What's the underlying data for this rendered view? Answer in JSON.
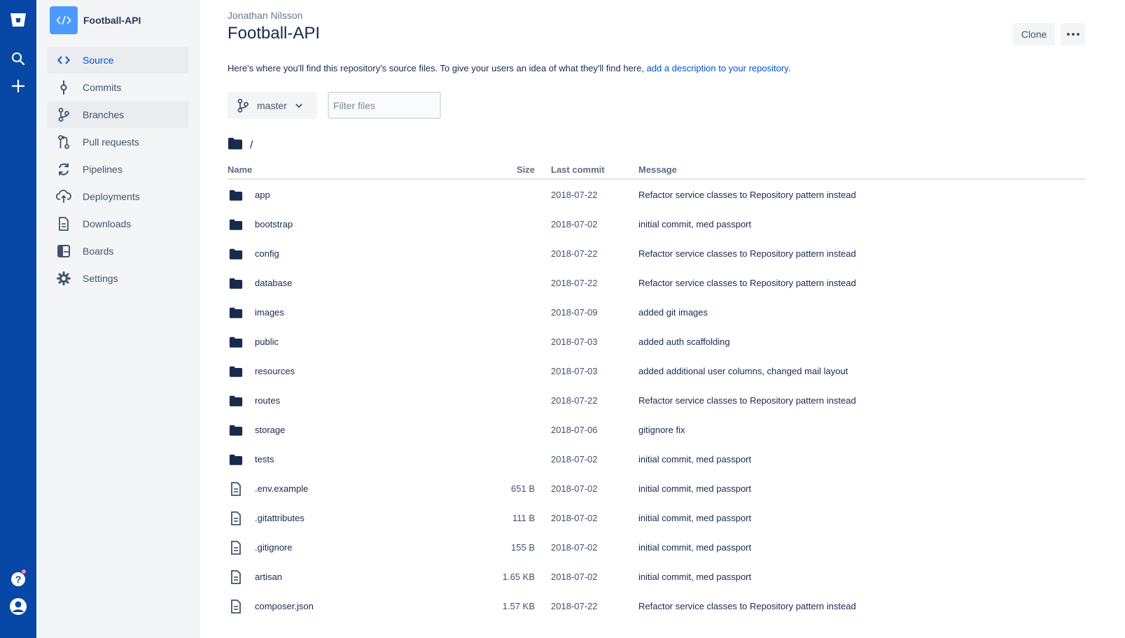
{
  "global_nav": {
    "icons": [
      "bitbucket-logo-icon",
      "search-icon",
      "create-plus-icon",
      "help-icon",
      "profile-avatar-icon"
    ]
  },
  "sidebar": {
    "repo_name": "Football-API",
    "items": [
      {
        "label": "Source",
        "icon": "source-code-icon",
        "active": true
      },
      {
        "label": "Commits",
        "icon": "commit-icon"
      },
      {
        "label": "Branches",
        "icon": "branch-icon",
        "active": true
      },
      {
        "label": "Pull requests",
        "icon": "pull-request-icon"
      },
      {
        "label": "Pipelines",
        "icon": "pipelines-icon"
      },
      {
        "label": "Deployments",
        "icon": "deployments-cloud-icon"
      },
      {
        "label": "Downloads",
        "icon": "downloads-document-icon"
      },
      {
        "label": "Boards",
        "icon": "boards-icon"
      },
      {
        "label": "Settings",
        "icon": "gear-icon"
      }
    ]
  },
  "header": {
    "owner": "Jonathan Nilsson",
    "title": "Football-API",
    "clone_label": "Clone",
    "more_label": "•••"
  },
  "description": {
    "text": "Here's where you'll find this repository's source files. To give your users an idea of what they'll find here, ",
    "link": "add a description to your repository",
    "suffix": "."
  },
  "controls": {
    "branch": "master",
    "filter_placeholder": "Filter files"
  },
  "path": {
    "sep": "/"
  },
  "table": {
    "headers": {
      "name": "Name",
      "size": "Size",
      "last_commit": "Last commit",
      "message": "Message"
    },
    "rows": [
      {
        "type": "folder",
        "name": "app",
        "size": "",
        "date": "2018-07-22",
        "message": "Refactor service classes to Repository pattern instead"
      },
      {
        "type": "folder",
        "name": "bootstrap",
        "size": "",
        "date": "2018-07-02",
        "message": "initial commit, med passport"
      },
      {
        "type": "folder",
        "name": "config",
        "size": "",
        "date": "2018-07-22",
        "message": "Refactor service classes to Repository pattern instead"
      },
      {
        "type": "folder",
        "name": "database",
        "size": "",
        "date": "2018-07-22",
        "message": "Refactor service classes to Repository pattern instead"
      },
      {
        "type": "folder",
        "name": "images",
        "size": "",
        "date": "2018-07-09",
        "message": "added git images"
      },
      {
        "type": "folder",
        "name": "public",
        "size": "",
        "date": "2018-07-03",
        "message": "added auth scaffolding"
      },
      {
        "type": "folder",
        "name": "resources",
        "size": "",
        "date": "2018-07-03",
        "message": "added additional user columns, changed mail layout"
      },
      {
        "type": "folder",
        "name": "routes",
        "size": "",
        "date": "2018-07-22",
        "message": "Refactor service classes to Repository pattern instead"
      },
      {
        "type": "folder",
        "name": "storage",
        "size": "",
        "date": "2018-07-06",
        "message": "gitignore fix"
      },
      {
        "type": "folder",
        "name": "tests",
        "size": "",
        "date": "2018-07-02",
        "message": "initial commit, med passport"
      },
      {
        "type": "file",
        "name": ".env.example",
        "size": "651 B",
        "date": "2018-07-02",
        "message": "initial commit, med passport"
      },
      {
        "type": "file",
        "name": ".gitattributes",
        "size": "111 B",
        "date": "2018-07-02",
        "message": "initial commit, med passport"
      },
      {
        "type": "file",
        "name": ".gitignore",
        "size": "155 B",
        "date": "2018-07-02",
        "message": "initial commit, med passport"
      },
      {
        "type": "file",
        "name": "artisan",
        "size": "1.65 KB",
        "date": "2018-07-02",
        "message": "initial commit, med passport"
      },
      {
        "type": "file",
        "name": "composer.json",
        "size": "1.57 KB",
        "date": "2018-07-22",
        "message": "Refactor service classes to Repository pattern instead"
      }
    ]
  },
  "colors": {
    "global_nav": "#0747a6",
    "sidebar": "#f4f5f7",
    "link": "#0052cc",
    "folder": "#172b4d"
  }
}
